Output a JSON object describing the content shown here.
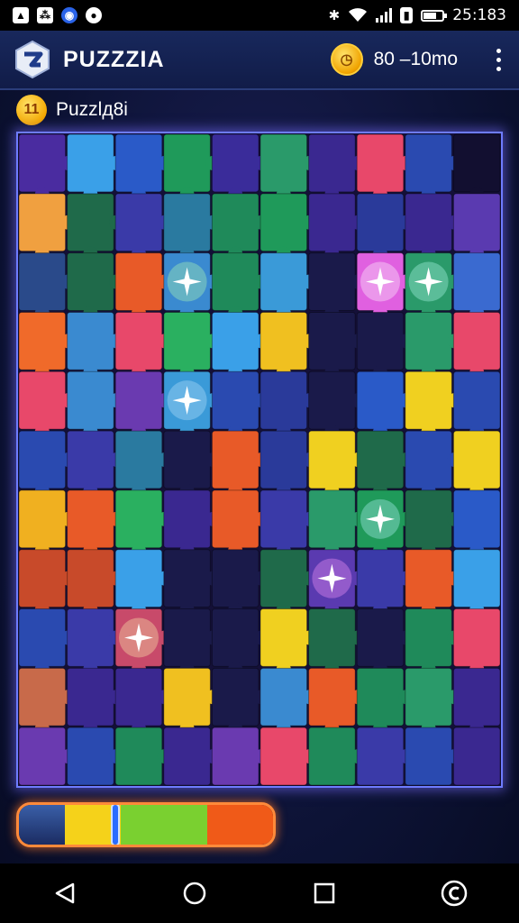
{
  "status_bar": {
    "time": "25:183",
    "left_icons": [
      "gallery-icon",
      "pdf-icon",
      "shield-app-icon",
      "record-icon"
    ],
    "right_icons": [
      "bluetooth-icon",
      "wifi-icon",
      "signal-icon",
      "sim-icon",
      "battery-icon"
    ]
  },
  "header": {
    "app_title": "PUZZZIA",
    "coins_text": "80 –10mo",
    "logo_icon": "puzzle-logo-icon",
    "coin_icon": "coin-icon",
    "menu_icon": "more-vertical-icon"
  },
  "level": {
    "badge_text": "11",
    "title": "Puzzlд8i"
  },
  "board": {
    "rows": 11,
    "cols": 10,
    "grid_colors": [
      [
        "#4a2ca0",
        "#3aa0e8",
        "#2a5ac8",
        "#1f9a5a",
        "#3a2c9a",
        "#2a9a6a",
        "#3a2890",
        "#e8486a",
        "#2a4ab0",
        "#120f30"
      ],
      [
        "#f0a040",
        "#1f6a4a",
        "#3a3aa8",
        "#2a7aa0",
        "#1f8a5a",
        "#1f9a5a",
        "#3a2890",
        "#2a3a9a",
        "#3a2890",
        "#5a3ab0"
      ],
      [
        "#2a4a8a",
        "#1f6a4a",
        "#e85a28",
        "#3a8ad0",
        "#1f8a5a",
        "#3a9ad8",
        "#1a1a4a",
        "#e060e0",
        "#2a9a6a",
        "#3a6ad0"
      ],
      [
        "#f06a2a",
        "#3a8ad0",
        "#e8486a",
        "#2ab060",
        "#3aa0e8",
        "#f0c020",
        "#1a1a4a",
        "#1a1a4a",
        "#2a9a6a",
        "#e8486a"
      ],
      [
        "#e8486a",
        "#3a8ad0",
        "#6a3ab0",
        "#3a9ad8",
        "#2a4ab0",
        "#2a3a9a",
        "#1a1a4a",
        "#2a5ac8",
        "#f0d020",
        "#2a4ab0"
      ],
      [
        "#2a4ab0",
        "#3a3aa8",
        "#2a7aa0",
        "#1a1a4a",
        "#e85a28",
        "#2a3a9a",
        "#f0d020",
        "#1f6a4a",
        "#2a4ab0",
        "#f0d020"
      ],
      [
        "#f0b020",
        "#e85a28",
        "#2ab060",
        "#3a2890",
        "#e85a28",
        "#3a3aa8",
        "#2a9a6a",
        "#1f9a5a",
        "#1f6a4a",
        "#2a5ac8"
      ],
      [
        "#c84a2a",
        "#c84a2a",
        "#3aa0e8",
        "#1a1a4a",
        "#1a1a4a",
        "#1f6a4a",
        "#5a3ab0",
        "#3a3aa8",
        "#e85a28",
        "#3aa0e8"
      ],
      [
        "#2a4ab0",
        "#3a3aa8",
        "#c84a6a",
        "#1a1a4a",
        "#1a1a4a",
        "#f0d020",
        "#1f6a4a",
        "#1a1a4a",
        "#1f8a5a",
        "#e8486a"
      ],
      [
        "#c86a4a",
        "#3a2890",
        "#3a2890",
        "#f0c020",
        "#1a1a4a",
        "#3a8ad0",
        "#e85a28",
        "#1f8a5a",
        "#2a9a6a",
        "#3a2890"
      ],
      [
        "#6a3ab0",
        "#2a4ab0",
        "#1f8a5a",
        "#3a2890",
        "#6a3ab0",
        "#e8486a",
        "#1f8a5a",
        "#3a3aa8",
        "#2a4ab0",
        "#3a2890"
      ]
    ],
    "sparkles": [
      {
        "col": 7,
        "row": 2,
        "color": "#ffffff"
      },
      {
        "col": 3,
        "row": 2,
        "color": "#b8ffb0"
      },
      {
        "col": 8,
        "row": 2,
        "color": "#b8fff0"
      },
      {
        "col": 3,
        "row": 4,
        "color": "#bfe6ff"
      },
      {
        "col": 7,
        "row": 6,
        "color": "#b8f6ff"
      },
      {
        "col": 6,
        "row": 7,
        "color": "#ff9aff"
      },
      {
        "col": 2,
        "row": 8,
        "color": "#fff6b0"
      }
    ]
  },
  "progress": {
    "fraction": 0.5,
    "segments": [
      {
        "color": "#f5d21a",
        "start": 0.18,
        "end": 0.4
      },
      {
        "color": "#7ad030",
        "start": 0.4,
        "end": 0.74
      },
      {
        "color": "#f05a18",
        "start": 0.74,
        "end": 1.0
      }
    ]
  },
  "nav": {
    "back_icon": "back-triangle-icon",
    "home_icon": "home-circle-icon",
    "recents_icon": "recents-square-icon",
    "extra_icon": "assistant-icon"
  },
  "colors": {
    "accent": "#6e7cff",
    "header_bg": "#18285c",
    "glow": "#ff8a3a"
  }
}
